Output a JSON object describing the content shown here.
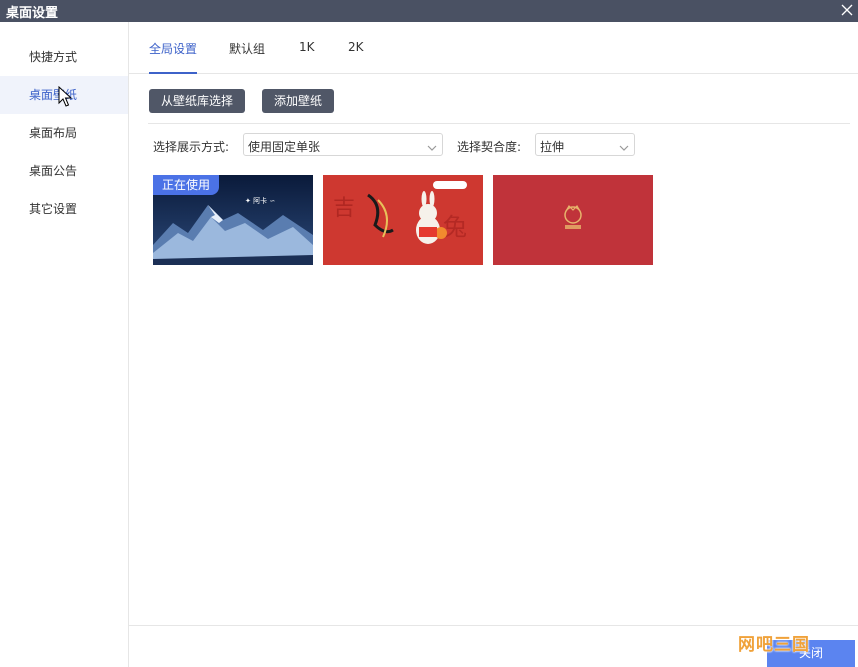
{
  "window": {
    "title": "桌面设置",
    "close_icon": "close-icon"
  },
  "sidebar": {
    "items": [
      {
        "label": "快捷方式",
        "active": false
      },
      {
        "label": "桌面壁纸",
        "active": true
      },
      {
        "label": "桌面布局",
        "active": false
      },
      {
        "label": "桌面公告",
        "active": false
      },
      {
        "label": "其它设置",
        "active": false
      }
    ]
  },
  "tabs": [
    {
      "label": "全局设置",
      "active": true
    },
    {
      "label": "默认组",
      "active": false
    },
    {
      "label": "1K",
      "active": false
    },
    {
      "label": "2K",
      "active": false
    }
  ],
  "toolbar": {
    "library_button": "从壁纸库选择",
    "add_button": "添加壁纸"
  },
  "options": {
    "display_mode_label": "选择展示方式:",
    "display_mode_value": "使用固定单张",
    "fit_label": "选择契合度:",
    "fit_value": "拉伸"
  },
  "wallpapers": [
    {
      "name": "snowy-mountain-wallpaper",
      "badge": "正在使用"
    },
    {
      "name": "red-rabbit-new-year-wallpaper",
      "badge": ""
    },
    {
      "name": "red-plain-logo-wallpaper",
      "badge": ""
    }
  ],
  "footer": {
    "close_button": "关闭"
  },
  "watermark": "网吧三国",
  "colors": {
    "accent": "#3d62c9",
    "titlebar": "#4a5163",
    "button_dark": "#505767",
    "badge": "#4b72e6"
  }
}
